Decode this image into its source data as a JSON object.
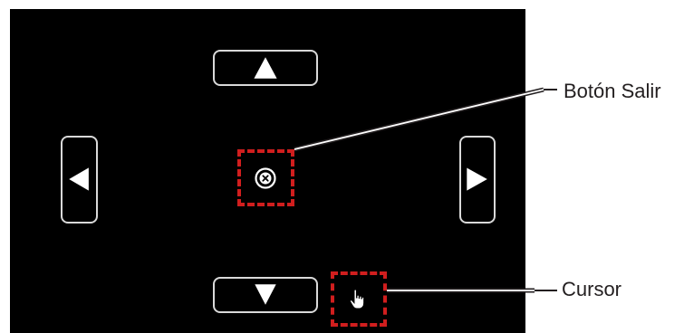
{
  "screen": {
    "background": "#000000",
    "button_border_color": "#d9d9d9",
    "arrow_color": "#ffffff",
    "navigation_buttons": [
      {
        "direction": "up",
        "icon": "triangle-up-icon"
      },
      {
        "direction": "down",
        "icon": "triangle-down-icon"
      },
      {
        "direction": "left",
        "icon": "triangle-left-icon"
      },
      {
        "direction": "right",
        "icon": "triangle-right-icon"
      }
    ],
    "exit_button_icon": "circle-x-icon",
    "cursor_icon": "hand-pointer-icon"
  },
  "callouts": {
    "highlight_color": "#d01e1e",
    "exit_label": "Botón Salir",
    "cursor_label": "Cursor"
  }
}
